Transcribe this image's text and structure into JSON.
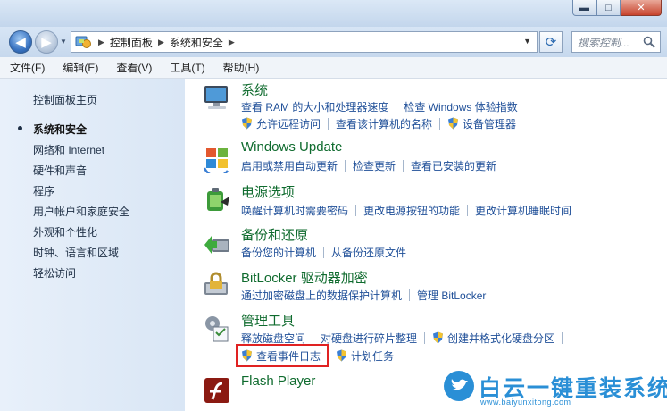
{
  "window": {
    "buttons": {
      "minimize": "▬",
      "maximize": "□",
      "close": "✕"
    }
  },
  "navbar": {
    "back_glyph": "◀",
    "forward_glyph": "▶",
    "breadcrumb": [
      "控制面板",
      "系统和安全"
    ],
    "refresh_glyph": "⟳",
    "search_placeholder": "搜索控制..."
  },
  "menubar": {
    "items": [
      "文件(F)",
      "编辑(E)",
      "查看(V)",
      "工具(T)",
      "帮助(H)"
    ]
  },
  "sidebar": {
    "items": [
      {
        "label": "控制面板主页"
      },
      {
        "label": "系统和安全",
        "active": true
      },
      {
        "label": "网络和 Internet"
      },
      {
        "label": "硬件和声音"
      },
      {
        "label": "程序"
      },
      {
        "label": "用户帐户和家庭安全"
      },
      {
        "label": "外观和个性化"
      },
      {
        "label": "时钟、语言和区域"
      },
      {
        "label": "轻松访问"
      }
    ]
  },
  "categories": {
    "system": {
      "title": "系统",
      "icon": "computer-icon",
      "row1": [
        "查看 RAM 的大小和处理器速度",
        "检查 Windows 体验指数"
      ],
      "row2": [
        "允许远程访问",
        "查看该计算机的名称",
        "设备管理器"
      ]
    },
    "windows_update": {
      "title": "Windows Update",
      "icon": "windows-update-icon",
      "row1": [
        "启用或禁用自动更新",
        "检查更新",
        "查看已安装的更新"
      ]
    },
    "power": {
      "title": "电源选项",
      "icon": "battery-icon",
      "row1": [
        "唤醒计算机时需要密码",
        "更改电源按钮的功能",
        "更改计算机睡眠时间"
      ]
    },
    "backup": {
      "title": "备份和还原",
      "icon": "backup-icon",
      "row1": [
        "备份您的计算机",
        "从备份还原文件"
      ]
    },
    "bitlocker": {
      "title": "BitLocker 驱动器加密",
      "icon": "bitlocker-icon",
      "row1": [
        "通过加密磁盘上的数据保护计算机",
        "管理 BitLocker"
      ]
    },
    "admin_tools": {
      "title": "管理工具",
      "icon": "admin-tools-icon",
      "row1": [
        "释放磁盘空间",
        "对硬盘进行碎片整理",
        "创建并格式化硬盘分区"
      ],
      "row2": [
        "查看事件日志",
        "计划任务"
      ]
    },
    "flash": {
      "title": "Flash Player",
      "icon": "flash-icon"
    }
  },
  "watermark": {
    "text": "白云一键重装系统",
    "url": "www.baiyunxitong.com"
  },
  "colors": {
    "link": "#1f4f98",
    "category_title": "#0f6b2e",
    "highlight": "#e02222",
    "watermark": "#2a8fd6"
  }
}
